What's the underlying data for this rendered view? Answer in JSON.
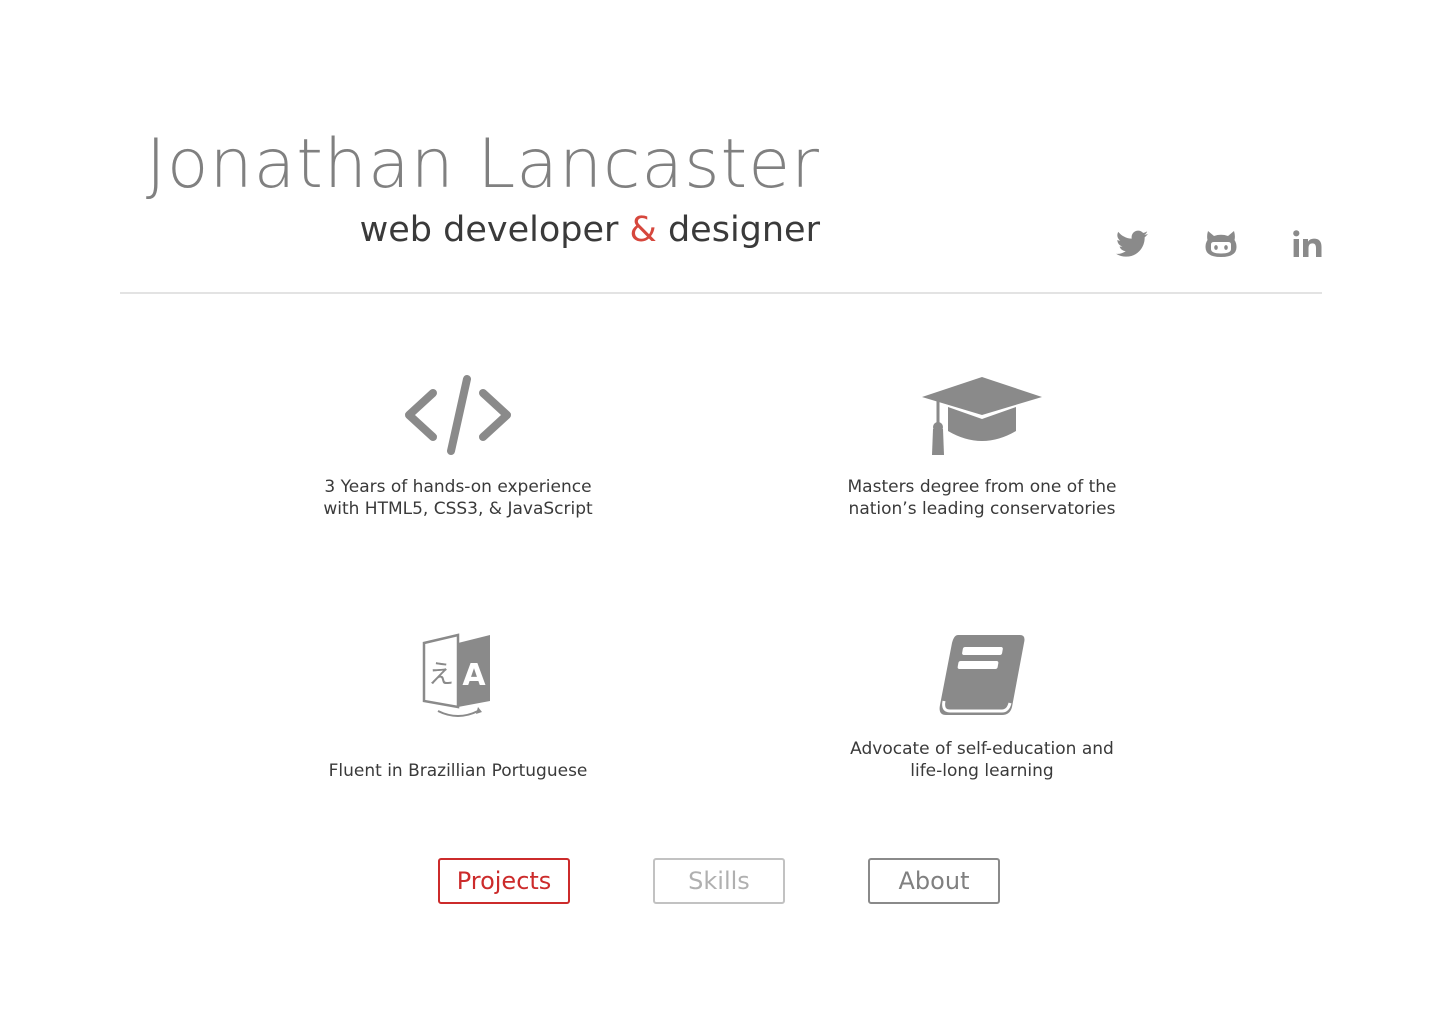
{
  "header": {
    "name": "Jonathan Lancaster",
    "tagline_before": "web developer ",
    "tagline_amp": "&",
    "tagline_after": " designer"
  },
  "social": [
    {
      "name": "twitter-icon"
    },
    {
      "name": "github-icon"
    },
    {
      "name": "linkedin-icon"
    }
  ],
  "features": [
    {
      "icon": "code-icon",
      "lines": [
        "3 Years of hands-on experience",
        "with HTML5, CSS3, & JavaScript"
      ]
    },
    {
      "icon": "graduation-cap-icon",
      "lines": [
        "Masters degree from one of the",
        "nation’s leading conservatories"
      ]
    },
    {
      "icon": "translate-icon",
      "lines": [
        "Fluent in Brazillian Portuguese"
      ]
    },
    {
      "icon": "book-icon",
      "lines": [
        "Advocate of self-education and",
        "life-long learning"
      ]
    }
  ],
  "nav": [
    {
      "label": "Projects",
      "state": "active",
      "color": "#cc2b2b"
    },
    {
      "label": "Skills",
      "state": "disabled",
      "color": "#b0b0b0"
    },
    {
      "label": "About",
      "state": "default",
      "color": "#808080"
    }
  ],
  "colors": {
    "accent": "#d6473d",
    "icon_gray": "#8a8a8a",
    "name_gray": "#808080",
    "text_dark": "#3a3a3a"
  }
}
